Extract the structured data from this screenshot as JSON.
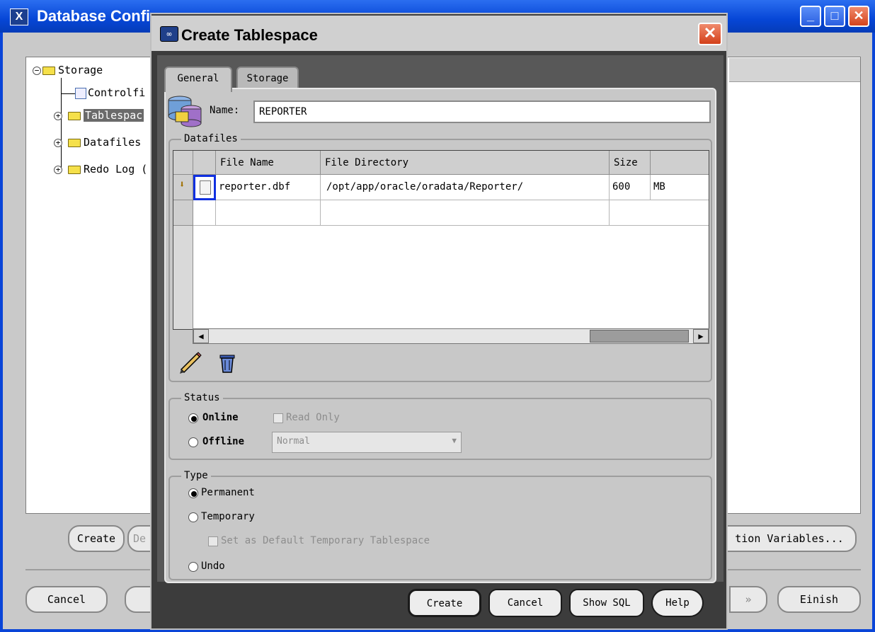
{
  "background_window": {
    "title": "Database Config",
    "app_icon_glyph": "X",
    "tree": {
      "root": "Storage",
      "items": [
        "Controlfi",
        "Tablespac",
        "Datafiles",
        "Redo Log ("
      ]
    },
    "buttons": {
      "create": "Create",
      "de": "De",
      "variables": "tion Variables...",
      "cancel": "Cancel",
      "next_arrow": "»",
      "finish": "Einish"
    }
  },
  "dialog": {
    "title": "Create Tablespace",
    "tabs": [
      "General",
      "Storage"
    ],
    "name_label": "Name:",
    "name_value": "REPORTER",
    "datafiles": {
      "group_title": "Datafiles",
      "columns": [
        "File Name",
        "File Directory",
        "Size"
      ],
      "rows": [
        {
          "file_name": "reporter.dbf",
          "directory": "/opt/app/oracle/oradata/Reporter/",
          "size": "600",
          "unit": "MB"
        }
      ]
    },
    "status": {
      "group_title": "Status",
      "online": "Online",
      "read_only": "Read Only",
      "offline": "Offline",
      "offline_mode": "Normal",
      "selected": "Online"
    },
    "type": {
      "group_title": "Type",
      "permanent": "Permanent",
      "temporary": "Temporary",
      "default_temp": "Set as Default Temporary Tablespace",
      "undo": "Undo",
      "selected": "Permanent"
    },
    "buttons": {
      "create": "Create",
      "cancel": "Cancel",
      "show_sql": "Show SQL",
      "help": "Help"
    }
  },
  "icons": [
    "app-icon",
    "close-icon",
    "minimize-icon",
    "maximize-icon",
    "database-icon",
    "pencil-icon",
    "trash-icon",
    "folder-icon",
    "controlfile-icon",
    "scroll-left-icon",
    "scroll-right-icon",
    "dropdown-icon"
  ],
  "colors": {
    "xp_title": "#0646d6",
    "dialog_frame": "#3c3c3c",
    "selection": "#6a6a6a",
    "focus_border": "#1030e0"
  }
}
